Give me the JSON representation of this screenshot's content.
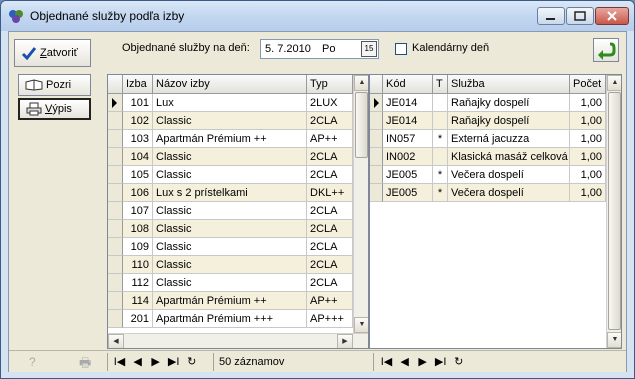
{
  "window": {
    "title": "Objednané služby podľa izby"
  },
  "toolbar": {
    "close_label": "Zatvoriť",
    "view_label": "Pozri",
    "print_label": "Výpis"
  },
  "filters": {
    "date_label": "Objednané služby na deň:",
    "date_value": "5. 7.2010",
    "day_of_week": "Po",
    "calendar_days_label": "Kalendárny deň",
    "calendar_days_checked": false
  },
  "rooms": {
    "columns": [
      "Izba",
      "Názov izby",
      "Typ"
    ],
    "rows": [
      [
        "101",
        "Lux",
        "2LUX"
      ],
      [
        "102",
        "Classic",
        "2CLA"
      ],
      [
        "103",
        "Apartmán Prémium ++",
        "AP++"
      ],
      [
        "104",
        "Classic",
        "2CLA"
      ],
      [
        "105",
        "Classic",
        "2CLA"
      ],
      [
        "106",
        "Lux s 2 prístelkami",
        "DKL++"
      ],
      [
        "107",
        "Classic",
        "2CLA"
      ],
      [
        "108",
        "Classic",
        "2CLA"
      ],
      [
        "109",
        "Classic",
        "2CLA"
      ],
      [
        "110",
        "Classic",
        "2CLA"
      ],
      [
        "112",
        "Classic",
        "2CLA"
      ],
      [
        "114",
        "Apartmán Prémium ++",
        "AP++"
      ],
      [
        "201",
        "Apartmán Prémium +++",
        "AP+++"
      ]
    ],
    "record_count": "50 záznamov"
  },
  "services": {
    "columns": [
      "Kód",
      "T",
      "Služba",
      "Počet"
    ],
    "rows": [
      [
        "JE014",
        "",
        "Raňajky dospelí",
        "1,00"
      ],
      [
        "JE014",
        "",
        "Raňajky dospelí",
        "1,00"
      ],
      [
        "IN057",
        "*",
        "Externá jacuzza",
        "1,00"
      ],
      [
        "IN002",
        "",
        "Klasická masáž celková",
        "1,00"
      ],
      [
        "JE005",
        "*",
        "Večera dospelí",
        "1,00"
      ],
      [
        "JE005",
        "*",
        "Večera dospelí",
        "1,00"
      ]
    ]
  },
  "nav": {
    "first": "I◀",
    "prev": "◀",
    "next": "▶",
    "last": "▶I",
    "refresh": "↻"
  },
  "colors": {
    "window_frame": "#6f8bb6",
    "alt_row": "#f4f0dc",
    "client": "#ece9d8"
  }
}
